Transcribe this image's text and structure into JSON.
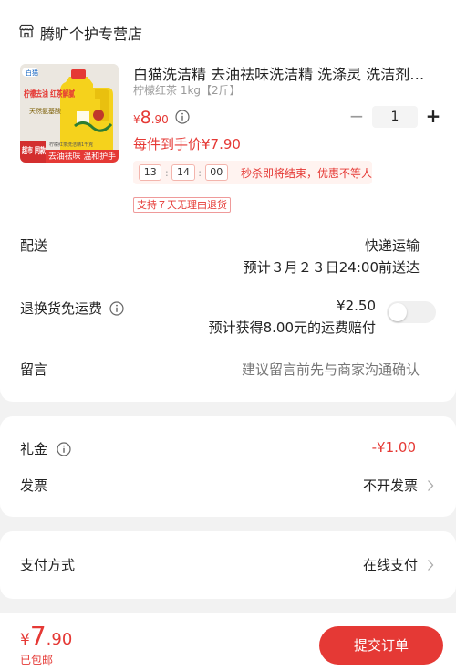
{
  "store": {
    "name": "腾旷个护专营店",
    "icon": "store-icon"
  },
  "product": {
    "title": "白猫洗洁精 去油祛味洗洁精 洗涤灵 洗洁剂…",
    "spec": "柠檬红茶 1kg【2斤】",
    "price_yen": "¥",
    "price_int": "8",
    "price_dec": ".90",
    "promo": "每件到手价¥7.90",
    "quantity": "1",
    "minus": "−",
    "plus": "+",
    "image_texts": {
      "brand": "白猫",
      "headline": "柠檬去油 红茶解腻",
      "subtitle": "天然氨基酸",
      "badge": "超市 同款",
      "footer": "去油祛味 温和护手",
      "small": "柠檬红茶洗洁精1千克"
    }
  },
  "countdown": {
    "hh": "13",
    "mm": "14",
    "ss": "00",
    "message": "秒杀即将结束，优惠不等人"
  },
  "return_tag": "支持７天无理由退货",
  "delivery": {
    "label": "配送",
    "method": "快递运输",
    "estimate": "预计３月２３日24:00前送达"
  },
  "return_insurance": {
    "label": "退换货免运费",
    "price": "¥2.50",
    "note": "预计获得8.00元的运费赔付"
  },
  "message": {
    "label": "留言",
    "placeholder": "建议留言前先与商家沟通确认"
  },
  "gift": {
    "label": "礼金",
    "value": "-¥1.00"
  },
  "invoice": {
    "label": "发票",
    "value": "不开发票"
  },
  "payment": {
    "label": "支付方式",
    "value": "在线支付"
  },
  "footer": {
    "total_yen": "¥",
    "total_int": "7",
    "total_dec": ".90",
    "shipping": "已包邮",
    "submit": "提交订单"
  },
  "colors": {
    "accent": "#e53935",
    "background": "#f2f2f2",
    "product_bottle": "#f5d21c"
  }
}
